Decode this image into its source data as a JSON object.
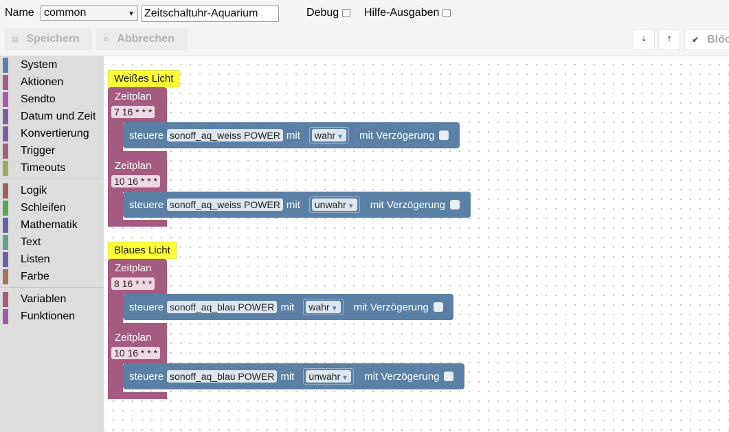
{
  "header": {
    "name_label": "Name",
    "type_select": "common",
    "script_name": "Zeitschaltuhr-Aquarium",
    "debug_label": "Debug",
    "help_label": "Hilfe-Ausgaben"
  },
  "toolbar": {
    "save_label": "Speichern",
    "cancel_label": "Abbrechen",
    "blocks_label": "Blöcke"
  },
  "toolbox": {
    "categories": [
      {
        "label": "System",
        "color": "#5b80a5"
      },
      {
        "label": "Aktionen",
        "color": "#a55b80"
      },
      {
        "label": "Sendto",
        "color": "#a55ba5"
      },
      {
        "label": "Datum und Zeit",
        "color": "#805ba5"
      },
      {
        "label": "Konvertierung",
        "color": "#805ba5"
      },
      {
        "label": "Trigger",
        "color": "#a55b80"
      },
      {
        "label": "Timeouts",
        "color": "#a5a55b"
      },
      {
        "label": "Logik",
        "color": "#a55b5b"
      },
      {
        "label": "Schleifen",
        "color": "#5ba55b"
      },
      {
        "label": "Mathematik",
        "color": "#5b67a5"
      },
      {
        "label": "Text",
        "color": "#5ba58c"
      },
      {
        "label": "Listen",
        "color": "#745ba5"
      },
      {
        "label": "Farbe",
        "color": "#a5745b"
      },
      {
        "label": "Variablen",
        "color": "#a55b80"
      },
      {
        "label": "Funktionen",
        "color": "#995ba5"
      }
    ]
  },
  "workspace": {
    "groups": [
      {
        "comment": "Weißes Licht",
        "schedules": [
          {
            "title": "Zeitplan",
            "cron": "7 16 * * *",
            "control": {
              "verb": "steuere",
              "object": "sonoff_aq_weiss POWER",
              "with": "mit",
              "value": "wahr",
              "delay": "mit Verzögerung"
            }
          },
          {
            "title": "Zeitplan",
            "cron": "10 16 * * *",
            "control": {
              "verb": "steuere",
              "object": "sonoff_aq_weiss POWER",
              "with": "mit",
              "value": "unwahr",
              "delay": "mit Verzögerung"
            }
          }
        ]
      },
      {
        "comment": "Blaues Licht",
        "schedules": [
          {
            "title": "Zeitplan",
            "cron": "8 16 * * *",
            "control": {
              "verb": "steuere",
              "object": "sonoff_aq_blau POWER",
              "with": "mit",
              "value": "wahr",
              "delay": "mit Verzögerung"
            }
          },
          {
            "title": "Zeitplan",
            "cron": "10 16 * * *",
            "control": {
              "verb": "steuere",
              "object": "sonoff_aq_blau POWER",
              "with": "mit",
              "value": "unwahr",
              "delay": "mit Verzögerung"
            }
          }
        ]
      }
    ]
  }
}
